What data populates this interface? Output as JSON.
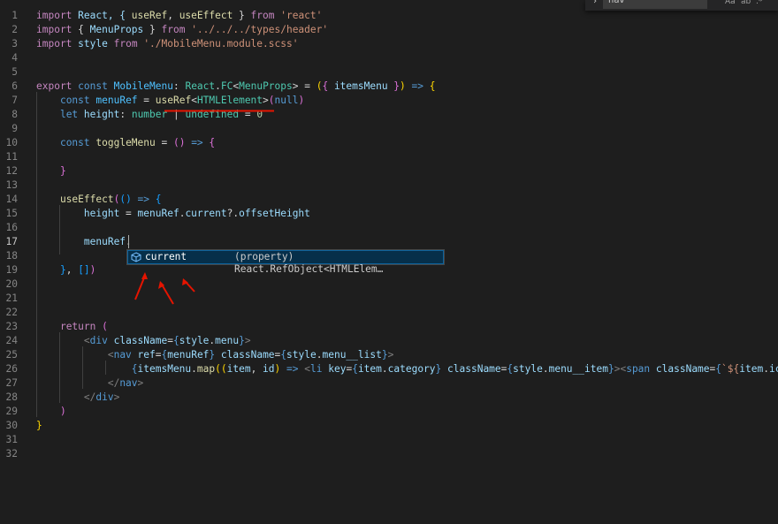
{
  "editor": {
    "language": "typescriptreact",
    "active_line": "17",
    "lines": [
      {
        "n": "1",
        "segments": [
          {
            "t": "import",
            "c": "ctrl"
          },
          {
            "t": " React, { ",
            "c": "var"
          },
          {
            "t": "useRef",
            "c": "fn"
          },
          {
            "t": ", ",
            "c": "plain"
          },
          {
            "t": "useEffect",
            "c": "fn"
          },
          {
            "t": " } ",
            "c": "plain"
          },
          {
            "t": "from",
            "c": "ctrl"
          },
          {
            "t": " ",
            "c": "plain"
          },
          {
            "t": "'react'",
            "c": "str"
          }
        ]
      },
      {
        "n": "2",
        "segments": [
          {
            "t": "import",
            "c": "ctrl"
          },
          {
            "t": " { ",
            "c": "plain"
          },
          {
            "t": "MenuProps",
            "c": "var"
          },
          {
            "t": " } ",
            "c": "plain"
          },
          {
            "t": "from",
            "c": "ctrl"
          },
          {
            "t": " ",
            "c": "plain"
          },
          {
            "t": "'../../../types/header'",
            "c": "str"
          }
        ]
      },
      {
        "n": "3",
        "segments": [
          {
            "t": "import",
            "c": "ctrl"
          },
          {
            "t": " ",
            "c": "plain"
          },
          {
            "t": "style",
            "c": "var"
          },
          {
            "t": " ",
            "c": "plain"
          },
          {
            "t": "from",
            "c": "ctrl"
          },
          {
            "t": " ",
            "c": "plain"
          },
          {
            "t": "'./MobileMenu.module.scss'",
            "c": "str"
          }
        ]
      },
      {
        "n": "4",
        "segments": []
      },
      {
        "n": "5",
        "segments": []
      },
      {
        "n": "6",
        "segments": [
          {
            "t": "export",
            "c": "ctrl"
          },
          {
            "t": " ",
            "c": "plain"
          },
          {
            "t": "const",
            "c": "kw"
          },
          {
            "t": " ",
            "c": "plain"
          },
          {
            "t": "MobileMenu",
            "c": "const"
          },
          {
            "t": ": ",
            "c": "plain"
          },
          {
            "t": "React",
            "c": "type"
          },
          {
            "t": ".",
            "c": "plain"
          },
          {
            "t": "FC",
            "c": "type"
          },
          {
            "t": "<",
            "c": "plain"
          },
          {
            "t": "MenuProps",
            "c": "type"
          },
          {
            "t": "> = ",
            "c": "plain"
          },
          {
            "t": "(",
            "c": "br"
          },
          {
            "t": "{ ",
            "c": "br2"
          },
          {
            "t": "itemsMenu",
            "c": "var"
          },
          {
            "t": " }",
            "c": "br2"
          },
          {
            "t": ")",
            "c": "br"
          },
          {
            "t": " => ",
            "c": "kw"
          },
          {
            "t": "{",
            "c": "br"
          }
        ]
      },
      {
        "n": "7",
        "segments": [
          {
            "t": "    ",
            "c": "plain"
          },
          {
            "t": "const",
            "c": "kw"
          },
          {
            "t": " ",
            "c": "plain"
          },
          {
            "t": "menuRef",
            "c": "const"
          },
          {
            "t": " = ",
            "c": "plain"
          },
          {
            "t": "useRef",
            "c": "fn"
          },
          {
            "t": "<",
            "c": "plain"
          },
          {
            "t": "HTMLElement",
            "c": "type"
          },
          {
            "t": ">",
            "c": "plain"
          },
          {
            "t": "(",
            "c": "br2"
          },
          {
            "t": "null",
            "c": "kw"
          },
          {
            "t": ")",
            "c": "br2"
          }
        ]
      },
      {
        "n": "8",
        "segments": [
          {
            "t": "    ",
            "c": "plain"
          },
          {
            "t": "let",
            "c": "kw"
          },
          {
            "t": " ",
            "c": "plain"
          },
          {
            "t": "height",
            "c": "var"
          },
          {
            "t": ": ",
            "c": "plain"
          },
          {
            "t": "number",
            "c": "type"
          },
          {
            "t": " | ",
            "c": "plain"
          },
          {
            "t": "undefined",
            "c": "type"
          },
          {
            "t": " = ",
            "c": "plain"
          },
          {
            "t": "0",
            "c": "num"
          }
        ]
      },
      {
        "n": "9",
        "segments": []
      },
      {
        "n": "10",
        "segments": [
          {
            "t": "    ",
            "c": "plain"
          },
          {
            "t": "const",
            "c": "kw"
          },
          {
            "t": " ",
            "c": "plain"
          },
          {
            "t": "toggleMenu",
            "c": "fn"
          },
          {
            "t": " = ",
            "c": "plain"
          },
          {
            "t": "()",
            "c": "br2"
          },
          {
            "t": " => ",
            "c": "kw"
          },
          {
            "t": "{",
            "c": "br2"
          }
        ]
      },
      {
        "n": "11",
        "segments": []
      },
      {
        "n": "12",
        "segments": [
          {
            "t": "    ",
            "c": "plain"
          },
          {
            "t": "}",
            "c": "br2"
          }
        ]
      },
      {
        "n": "13",
        "segments": []
      },
      {
        "n": "14",
        "segments": [
          {
            "t": "    ",
            "c": "plain"
          },
          {
            "t": "useEffect",
            "c": "fn"
          },
          {
            "t": "(",
            "c": "br2"
          },
          {
            "t": "()",
            "c": "br3"
          },
          {
            "t": " => ",
            "c": "kw"
          },
          {
            "t": "{",
            "c": "br3"
          }
        ]
      },
      {
        "n": "15",
        "segments": [
          {
            "t": "        ",
            "c": "plain"
          },
          {
            "t": "height",
            "c": "var"
          },
          {
            "t": " = ",
            "c": "plain"
          },
          {
            "t": "menuRef",
            "c": "var"
          },
          {
            "t": ".",
            "c": "plain"
          },
          {
            "t": "current",
            "c": "var"
          },
          {
            "t": "?.",
            "c": "plain"
          },
          {
            "t": "offsetHeight",
            "c": "var"
          }
        ]
      },
      {
        "n": "16",
        "segments": []
      },
      {
        "n": "17",
        "segments": [
          {
            "t": "        ",
            "c": "plain"
          },
          {
            "t": "menuRef",
            "c": "var"
          },
          {
            "t": ".",
            "c": "plain"
          }
        ]
      },
      {
        "n": "18",
        "segments": []
      },
      {
        "n": "19",
        "segments": [
          {
            "t": "    ",
            "c": "plain"
          },
          {
            "t": "}",
            "c": "br3"
          },
          {
            "t": ", ",
            "c": "plain"
          },
          {
            "t": "[]",
            "c": "br3"
          },
          {
            "t": ")",
            "c": "br2"
          }
        ]
      },
      {
        "n": "20",
        "segments": []
      },
      {
        "n": "21",
        "segments": []
      },
      {
        "n": "22",
        "segments": []
      },
      {
        "n": "23",
        "segments": [
          {
            "t": "    ",
            "c": "plain"
          },
          {
            "t": "return",
            "c": "ctrl"
          },
          {
            "t": " ",
            "c": "plain"
          },
          {
            "t": "(",
            "c": "br2"
          }
        ]
      },
      {
        "n": "24",
        "segments": [
          {
            "t": "        ",
            "c": "plain"
          },
          {
            "t": "<",
            "c": "tag"
          },
          {
            "t": "div",
            "c": "tagname"
          },
          {
            "t": " ",
            "c": "plain"
          },
          {
            "t": "className",
            "c": "attr"
          },
          {
            "t": "=",
            "c": "plain"
          },
          {
            "t": "{",
            "c": "kw"
          },
          {
            "t": "style",
            "c": "var"
          },
          {
            "t": ".",
            "c": "plain"
          },
          {
            "t": "menu",
            "c": "var"
          },
          {
            "t": "}",
            "c": "kw"
          },
          {
            "t": ">",
            "c": "tag"
          }
        ]
      },
      {
        "n": "25",
        "segments": [
          {
            "t": "            ",
            "c": "plain"
          },
          {
            "t": "<",
            "c": "tag"
          },
          {
            "t": "nav",
            "c": "tagname"
          },
          {
            "t": " ",
            "c": "plain"
          },
          {
            "t": "ref",
            "c": "attr"
          },
          {
            "t": "=",
            "c": "plain"
          },
          {
            "t": "{",
            "c": "kw"
          },
          {
            "t": "menuRef",
            "c": "var"
          },
          {
            "t": "}",
            "c": "kw"
          },
          {
            "t": " ",
            "c": "plain"
          },
          {
            "t": "className",
            "c": "attr"
          },
          {
            "t": "=",
            "c": "plain"
          },
          {
            "t": "{",
            "c": "kw"
          },
          {
            "t": "style",
            "c": "var"
          },
          {
            "t": ".",
            "c": "plain"
          },
          {
            "t": "menu__list",
            "c": "var"
          },
          {
            "t": "}",
            "c": "kw"
          },
          {
            "t": ">",
            "c": "tag"
          }
        ]
      },
      {
        "n": "26",
        "segments": [
          {
            "t": "                ",
            "c": "plain"
          },
          {
            "t": "{",
            "c": "kw"
          },
          {
            "t": "itemsMenu",
            "c": "var"
          },
          {
            "t": ".",
            "c": "plain"
          },
          {
            "t": "map",
            "c": "fn"
          },
          {
            "t": "((",
            "c": "br"
          },
          {
            "t": "item",
            "c": "var"
          },
          {
            "t": ", ",
            "c": "plain"
          },
          {
            "t": "id",
            "c": "var"
          },
          {
            "t": ")",
            "c": "br"
          },
          {
            "t": " => ",
            "c": "kw"
          },
          {
            "t": "<",
            "c": "tag"
          },
          {
            "t": "li",
            "c": "tagname"
          },
          {
            "t": " ",
            "c": "plain"
          },
          {
            "t": "key",
            "c": "attr"
          },
          {
            "t": "=",
            "c": "plain"
          },
          {
            "t": "{",
            "c": "kw"
          },
          {
            "t": "item",
            "c": "var"
          },
          {
            "t": ".",
            "c": "plain"
          },
          {
            "t": "category",
            "c": "var"
          },
          {
            "t": "}",
            "c": "kw"
          },
          {
            "t": " ",
            "c": "plain"
          },
          {
            "t": "className",
            "c": "attr"
          },
          {
            "t": "=",
            "c": "plain"
          },
          {
            "t": "{",
            "c": "kw"
          },
          {
            "t": "style",
            "c": "var"
          },
          {
            "t": ".",
            "c": "plain"
          },
          {
            "t": "menu__item",
            "c": "var"
          },
          {
            "t": "}",
            "c": "kw"
          },
          {
            "t": ">",
            "c": "tag"
          },
          {
            "t": "<",
            "c": "tag"
          },
          {
            "t": "span",
            "c": "tagname"
          },
          {
            "t": " ",
            "c": "plain"
          },
          {
            "t": "className",
            "c": "attr"
          },
          {
            "t": "=",
            "c": "plain"
          },
          {
            "t": "{",
            "c": "kw"
          },
          {
            "t": "`${",
            "c": "str"
          },
          {
            "t": "item",
            "c": "var"
          },
          {
            "t": ".",
            "c": "plain"
          },
          {
            "t": "icon",
            "c": "var"
          },
          {
            "t": "}",
            "c": "str"
          },
          {
            "t": " ${",
            "c": "str"
          }
        ]
      },
      {
        "n": "27",
        "segments": [
          {
            "t": "            ",
            "c": "plain"
          },
          {
            "t": "</",
            "c": "tag"
          },
          {
            "t": "nav",
            "c": "tagname"
          },
          {
            "t": ">",
            "c": "tag"
          }
        ]
      },
      {
        "n": "28",
        "segments": [
          {
            "t": "        ",
            "c": "plain"
          },
          {
            "t": "</",
            "c": "tag"
          },
          {
            "t": "div",
            "c": "tagname"
          },
          {
            "t": ">",
            "c": "tag"
          }
        ]
      },
      {
        "n": "29",
        "segments": [
          {
            "t": "    ",
            "c": "plain"
          },
          {
            "t": ")",
            "c": "br2"
          }
        ]
      },
      {
        "n": "30",
        "segments": [
          {
            "t": "}",
            "c": "br"
          }
        ]
      },
      {
        "n": "31",
        "segments": []
      },
      {
        "n": "32",
        "segments": []
      }
    ]
  },
  "find_widget": {
    "search_value": "nav",
    "options": [
      "Aa",
      "ab",
      ".*"
    ]
  },
  "suggest_widget": {
    "icon": "property-icon",
    "label": "current",
    "detail": "(property) React.RefObject<HTMLElem…"
  },
  "colors": {
    "background": "#1e1e1e",
    "keyword": "#569cd6",
    "control": "#c586c0",
    "string": "#ce9178",
    "type": "#4ec9b0",
    "function": "#dcdcaa",
    "variable": "#9cdcfe",
    "annotation_red": "#e51400"
  }
}
